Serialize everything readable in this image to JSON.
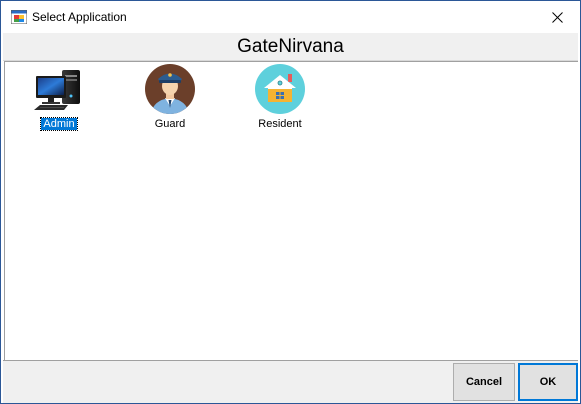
{
  "window": {
    "title": "Select Application",
    "close_glyph": "✕"
  },
  "banner": {
    "title": "GateNirvana"
  },
  "applications": [
    {
      "label": "Admin",
      "icon": "computer-icon",
      "selected": true
    },
    {
      "label": "Guard",
      "icon": "guard-avatar-icon",
      "selected": false
    },
    {
      "label": "Resident",
      "icon": "house-icon",
      "selected": false
    }
  ],
  "footer": {
    "cancel_label": "Cancel",
    "ok_label": "OK"
  },
  "colors": {
    "selection": "#0078d7",
    "guard_bg": "#6b3f2a",
    "resident_bg": "#5ed0dc"
  }
}
